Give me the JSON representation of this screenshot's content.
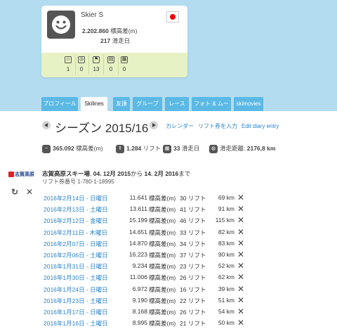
{
  "profile": {
    "name": "Skier S",
    "vertical_value": "2.202.860",
    "vertical_label": "標高差(m)",
    "days_value": "217",
    "days_label": "滑走日",
    "mini_stats": [
      {
        "icon": "smiley-icon",
        "glyph": "☺",
        "value": "1"
      },
      {
        "icon": "target-icon",
        "glyph": "◎",
        "value": "0"
      },
      {
        "icon": "flag-icon",
        "glyph": "⚑",
        "value": "13"
      },
      {
        "icon": "page-icon",
        "glyph": "▤",
        "value": "0"
      },
      {
        "icon": "film-icon",
        "glyph": "▦",
        "value": "0"
      }
    ]
  },
  "tabs": [
    "プロフィール",
    "Skilines",
    "友達",
    "グループ",
    "レース",
    "フォト & ムービー",
    "skimovies"
  ],
  "active_tab": "Skilines",
  "season": {
    "title": "シーズン 2015/16",
    "links": [
      "カレンダー",
      "リフト券を入力",
      "Edit diary entry"
    ]
  },
  "totals": {
    "vertical_value": "365.092",
    "vertical_label": "標高差(m)",
    "lifts_value": "1.284",
    "lifts_label": "リフト",
    "days_value": "33",
    "days_label": "滑走日",
    "distance_label": "滑走距離:",
    "distance_value": "2176,8 km"
  },
  "resort": {
    "logo_text": "志賀高原",
    "name": "志賀高原スキー場",
    "date_from": "04. 12月 2015",
    "from_text": "から",
    "date_to": "14. 2月 2016",
    "to_text": "まで",
    "pass_label": "リフト券番号",
    "pass_number": "1-780-1-18995"
  },
  "entries": [
    {
      "date": "2016年2月14日 - 日曜日",
      "vertical": "11.641",
      "unit": "標高差(m)",
      "lifts": "30 リフト",
      "distance": "69 km"
    },
    {
      "date": "2016年2月13日 - 土曜日",
      "vertical": "13.611",
      "unit": "標高差(m)",
      "lifts": "41 リフト",
      "distance": "91 km"
    },
    {
      "date": "2016年2月12日 - 金曜日",
      "vertical": "15.199",
      "unit": "標高差(m)",
      "lifts": "46 リフト",
      "distance": "115 km"
    },
    {
      "date": "2016年2月11日 - 木曜日",
      "vertical": "14.651",
      "unit": "標高差(m)",
      "lifts": "33 リフト",
      "distance": "82 km"
    },
    {
      "date": "2016年2月07日 - 日曜日",
      "vertical": "14.870",
      "unit": "標高差(m)",
      "lifts": "34 リフト",
      "distance": "83 km"
    },
    {
      "date": "2016年2月06日 - 土曜日",
      "vertical": "16.223",
      "unit": "標高差(m)",
      "lifts": "37 リフト",
      "distance": "90 km"
    },
    {
      "date": "2016年1月31日 - 日曜日",
      "vertical": "9.234",
      "unit": "標高差(m)",
      "lifts": "23 リフト",
      "distance": "52 km"
    },
    {
      "date": "2016年1月30日 - 土曜日",
      "vertical": "11.006",
      "unit": "標高差(m)",
      "lifts": "26 リフト",
      "distance": "62 km"
    },
    {
      "date": "2016年1月24日 - 日曜日",
      "vertical": "6.972",
      "unit": "標高差(m)",
      "lifts": "16 リフト",
      "distance": "39 km"
    },
    {
      "date": "2016年1月23日 - 土曜日",
      "vertical": "9.190",
      "unit": "標高差(m)",
      "lifts": "22 リフト",
      "distance": "51 km"
    },
    {
      "date": "2016年1月17日 - 日曜日",
      "vertical": "8.168",
      "unit": "標高差(m)",
      "lifts": "26 リフト",
      "distance": "54 km"
    },
    {
      "date": "2016年1月16日 - 土曜日",
      "vertical": "8.995",
      "unit": "標高差(m)",
      "lifts": "21 リフト",
      "distance": "50 km"
    }
  ]
}
